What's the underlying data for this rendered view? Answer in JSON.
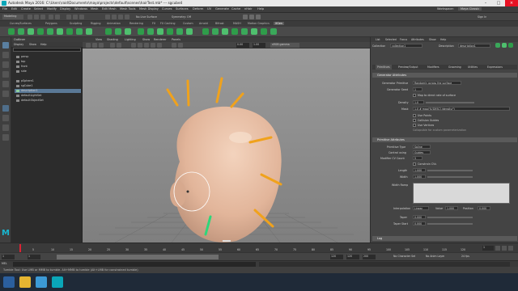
{
  "window": {
    "title": "Autodesk Maya 2016: C:\\Users\\raid\\Documents\\maya\\projects\\default\\scenes\\hairTest.mb* --- sgcube4"
  },
  "menubar": {
    "items": [
      "File",
      "Edit",
      "Create",
      "Select",
      "Modify",
      "Display",
      "Windows",
      "Mesh",
      "Edit Mesh",
      "Mesh Tools",
      "Mesh Display",
      "Curves",
      "Surfaces",
      "Deform",
      "UV",
      "Generate",
      "Cache",
      "nHair",
      "Help"
    ],
    "workspace_label": "Workspace:",
    "workspace_value": "Maya Classic"
  },
  "statusline": {
    "mode": "Modeling",
    "no_live_surface": "No Live Surface",
    "symmetry": "Symmetry: Off",
    "signin": "Sign In"
  },
  "shelf": {
    "tabs": [
      "Curves/Surfaces",
      "Polygons",
      "Sculpting",
      "Rigging",
      "Animation",
      "Rendering",
      "FX",
      "FX Caching",
      "Custom",
      "Arnold",
      "Bifrost",
      "MASH",
      "Motion Graphics",
      "XGen"
    ]
  },
  "outliner": {
    "title": "Outliner",
    "menus": [
      "Display",
      "Show",
      "Help"
    ],
    "items": [
      {
        "label": "persp"
      },
      {
        "label": "top"
      },
      {
        "label": "front"
      },
      {
        "label": "side"
      },
      {
        "label": "pSphere1"
      },
      {
        "label": "sgCube1"
      },
      {
        "label": "description1"
      },
      {
        "label": "defaultLightSet"
      },
      {
        "label": "defaultObjectSet"
      }
    ]
  },
  "viewport": {
    "menus": [
      "View",
      "Shading",
      "Lighting",
      "Show",
      "Renderer",
      "Panels"
    ],
    "field_a": "0.00",
    "field_b": "1.00",
    "color_space": "sRGB gamma"
  },
  "attribute_editor": {
    "tabs_top": [
      "List",
      "Selected",
      "Focus",
      "Attributes",
      "Show",
      "Help"
    ],
    "collection_label": "Collection",
    "collection_value": "collection1",
    "description_label": "Description",
    "description_value": "description1",
    "tabs": [
      "Primitives",
      "Preview/Output",
      "Modifiers",
      "Grooming",
      "Utilities",
      "Expressions"
    ],
    "section_generator": "Generator Attributes",
    "generator_primitive_label": "Generator Primitive",
    "generator_primitive_value": "Randomly across the surface",
    "generator_seed_label": "Generator Seed",
    "generator_seed_value": "1",
    "map_option": "Map to direct rate of surface",
    "density_label": "Density",
    "density_value": "1.0",
    "mask_label": "Mask",
    "mask_value": "1.0 # map('${DESC}/density/')",
    "use_points": "Use Points",
    "collision_guides": "Collision Guides",
    "use_vertices": "Use Vertices",
    "collapsible": "Collapsible for custom parameterization",
    "section_primitive": "Primitive Attributes",
    "primitive_type_label": "Primitive Type",
    "primitive_type_value": "Spline",
    "control_using_label": "Control using",
    "control_using_value": "Guides",
    "modifier_cv_label": "Modifier CV Count",
    "modifier_cv_value": "5",
    "constrain_label": "Constrain CVs",
    "length_label": "Length",
    "length_value": "1.000",
    "width_label": "Width",
    "width_value": "1.000",
    "width_ramp_label": "Width Ramp",
    "interpolation_label": "Interpolation",
    "interpolation_value": "Linear",
    "value_label": "Value",
    "value_value": "1.000",
    "position_label": "Position",
    "position_value": "0.000",
    "taper_label": "Taper",
    "taper_value": "0.000",
    "taper_start_label": "Taper Start",
    "taper_start_value": "0.000",
    "log_label": "Log"
  },
  "timeline": {
    "ticks": [
      "5",
      "10",
      "15",
      "20",
      "25",
      "30",
      "35",
      "40",
      "45",
      "50",
      "55",
      "60",
      "65",
      "70",
      "75",
      "80",
      "85",
      "90",
      "95",
      "100",
      "105",
      "110",
      "115",
      "120"
    ],
    "current_frame": "1",
    "range_start": "1",
    "range_start_b": "1",
    "range_end": "120",
    "range_end_b": "120",
    "anim_end": "200",
    "char_set": "No Character Set",
    "anim_layer": "No Anim Layer",
    "fps": "24 fps"
  },
  "helpline": {
    "text": "Tumble Tool: Use LMB or MMB to tumble. Alt+MMB to tumble (Alt+LMB for constrained tumble)"
  },
  "colors": {
    "hair_orange": "#f0a21c",
    "guide_green": "#2fd67a",
    "head_skin": "#e8bfa5",
    "viewport_bg": "#8f8f8f"
  }
}
